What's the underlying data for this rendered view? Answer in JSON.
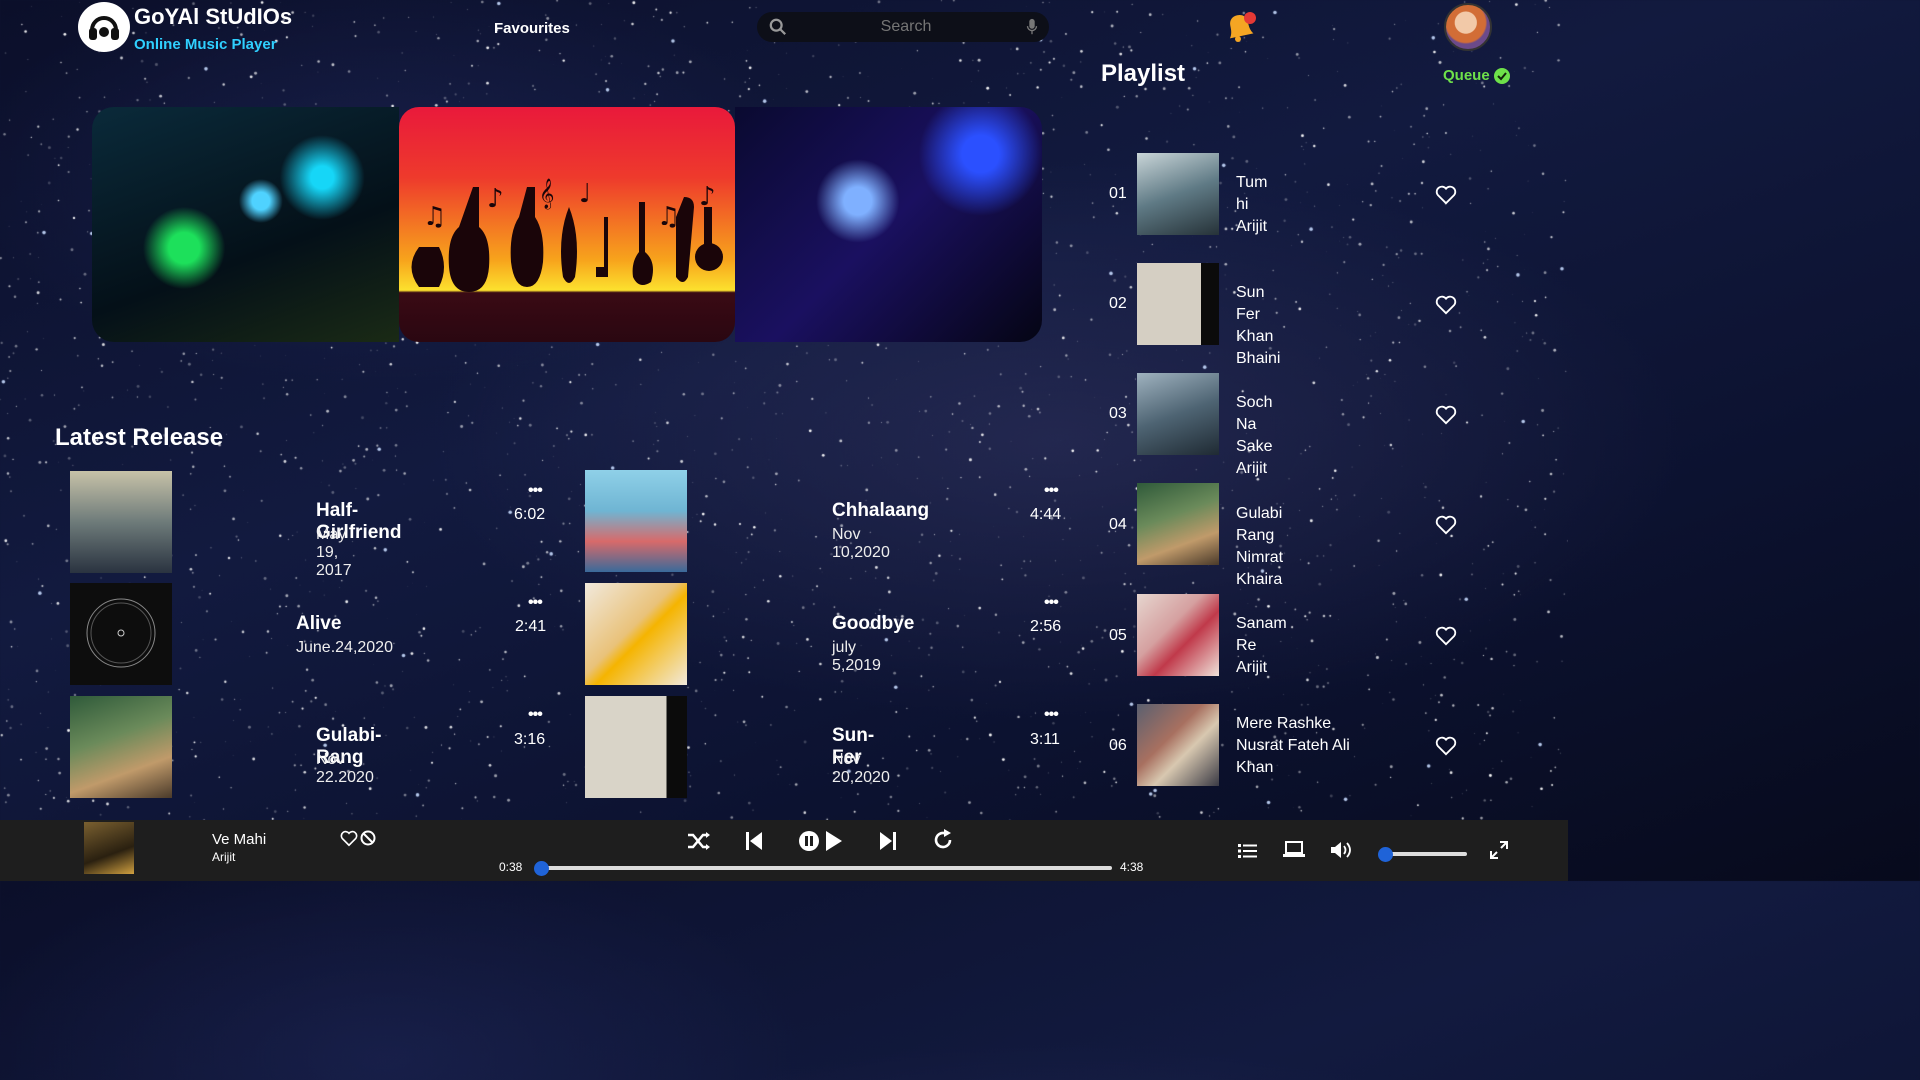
{
  "brand": {
    "title": "GoYAl StUdIOs",
    "subtitle": "Online Music Player"
  },
  "nav": {
    "favourites": "Favourites"
  },
  "search": {
    "placeholder": "Search"
  },
  "icons": {
    "logo": "headphones-logo-icon",
    "search": "search-icon",
    "mic": "mic-icon",
    "bell": "bell-icon",
    "heart": "heart-icon",
    "block": "block-icon",
    "shuffle": "shuffle-icon",
    "prev": "previous-icon",
    "pause": "pause-icon",
    "play": "play-icon",
    "next": "next-icon",
    "repeat": "repeat-icon",
    "queue_list": "list-icon",
    "device": "laptop-icon",
    "volume": "volume-icon",
    "fullscreen": "fullscreen-icon",
    "queue_check": "check-circle-icon"
  },
  "colors": {
    "accent": "#1f63d8",
    "brand_sub": "#2fd0ff",
    "queue": "#6ee14a",
    "bell": "#f5a623",
    "bell_dot": "#e53935"
  },
  "latest": {
    "title": "Latest Release",
    "items": [
      {
        "name": "Half-Girlfriend",
        "date": "May 19, 2017",
        "dots": "•••",
        "duration": "6:02"
      },
      {
        "name": "Alive",
        "date": "June.24,2020",
        "dots": "•••",
        "duration": "2:41"
      },
      {
        "name": "Gulabi-Rang",
        "date": "Nov 22.2020",
        "dots": "•••",
        "duration": "3:16"
      },
      {
        "name": "Chhalaang",
        "date": "Nov 10,2020",
        "dots": "•••",
        "duration": "4:44"
      },
      {
        "name": "Goodbye",
        "date": "july 5,2019",
        "dots": "•••",
        "duration": "2:56"
      },
      {
        "name": "Sun-Fer",
        "date": "Nov 20,2020",
        "dots": "•••",
        "duration": "3:11"
      }
    ]
  },
  "playlist": {
    "title": "Playlist",
    "queue_label": "Queue",
    "items": [
      {
        "num": "01",
        "title": "Tum hi",
        "artist": "Arijit"
      },
      {
        "num": "02",
        "title": "Sun Fer",
        "artist": "Khan Bhaini"
      },
      {
        "num": "03",
        "title": "Soch Na Sake",
        "artist": "Arijit"
      },
      {
        "num": "04",
        "title": "Gulabi Rang",
        "artist": "Nimrat Khaira"
      },
      {
        "num": "05",
        "title": "Sanam Re",
        "artist": "Arijit"
      },
      {
        "num": "06",
        "title": "Mere Rashke",
        "artist": "Nusrat Fateh Ali Khan"
      }
    ]
  },
  "player": {
    "title": "Ve Mahi",
    "artist": "Arijit",
    "elapsed": "0:38",
    "total": "4:38",
    "progress_fraction": 0.0,
    "volume_fraction": 0.0
  }
}
